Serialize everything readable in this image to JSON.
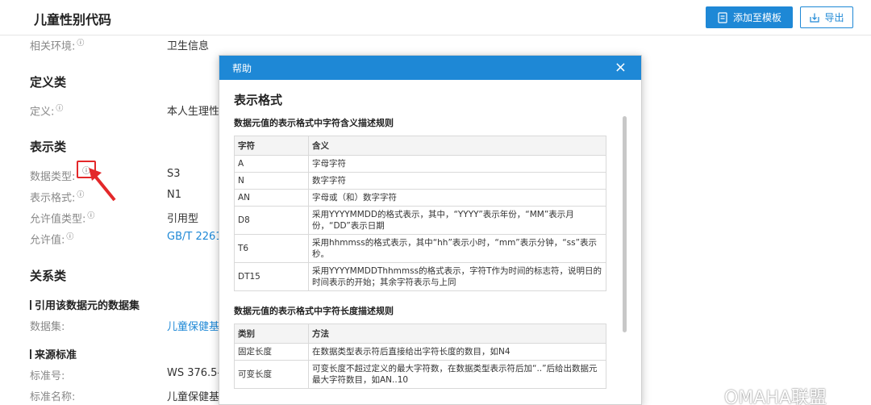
{
  "header": {
    "title": "儿童性别代码",
    "add_template_label": "添加至模板",
    "export_label": "导出",
    "accent_color": "#1e88d6"
  },
  "content": {
    "env_label": "相关环境:",
    "env_value": "卫生信息",
    "info_glyph": "ⓘ",
    "definition_heading": "定义类",
    "definition_label": "定义:",
    "definition_value": "本人生理性",
    "representation_heading": "表示类",
    "fields": [
      {
        "label": "数据类型:",
        "value": "S3"
      },
      {
        "label": "表示格式:",
        "value": "N1"
      },
      {
        "label": "允许值类型:",
        "value": "引用型"
      },
      {
        "label": "允许值:",
        "value": "GB/T 2261"
      }
    ],
    "relation_heading": "关系类",
    "ref_subheading": "引用该数据元的数据集",
    "dataset_label": "数据集:",
    "dataset_value": "儿童保健基",
    "source_subheading": "来源标准",
    "std_no_label": "标准号:",
    "std_no_value": "WS 376.5-",
    "std_name_label": "标准名称:",
    "std_name_value": "儿童保健基"
  },
  "modal": {
    "title": "帮助",
    "close_glyph": "×",
    "heading": "表示格式",
    "table1_caption": "数据元值的表示格式中字符含义描述规则",
    "table1_headers": [
      "字符",
      "含义"
    ],
    "table1_rows": [
      [
        "A",
        "字母字符"
      ],
      [
        "N",
        "数字字符"
      ],
      [
        "AN",
        "字母或（和）数字字符"
      ],
      [
        "D8",
        "采用YYYYMMDD的格式表示，其中，“YYYY”表示年份，“MM”表示月份，“DD”表示日期"
      ],
      [
        "T6",
        "采用hhmmss的格式表示，其中“hh”表示小时，“mm”表示分钟，“ss”表示秒。"
      ],
      [
        "DT15",
        "采用YYYYMMDDThhmmss的格式表示，字符T作为时间的标志符，说明日的时间表示的开始；其余字符表示与上同"
      ]
    ],
    "table2_caption": "数据元值的表示格式中字符长度描述规则",
    "table2_headers": [
      "类别",
      "方法"
    ],
    "table2_rows": [
      [
        "固定长度",
        "在数据类型表示符后直接给出字符长度的数目，如N4"
      ],
      [
        "可变长度",
        "可变长度不超过定义的最大字符数，在数据类型表示符后加“..”后给出数据元最大字符数目，如AN..10"
      ]
    ]
  },
  "watermark": {
    "text": "OMAHA联盟"
  }
}
